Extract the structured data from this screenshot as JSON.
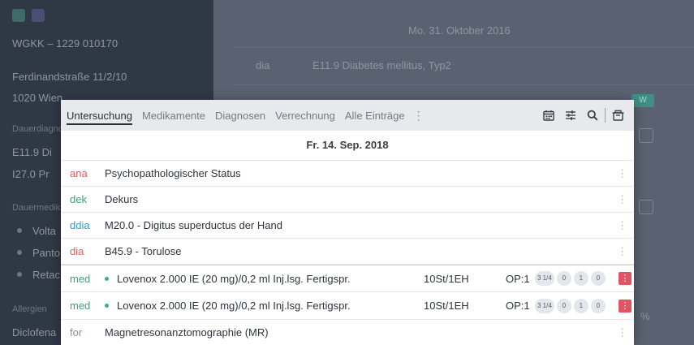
{
  "background": {
    "sidebar": {
      "insurer": "WGKK – 1229 010170",
      "address1": "Ferdinandstraße 11/2/10",
      "address2": "1020 Wien",
      "section1": "Dauerdiagnosen",
      "diag1": "E11.9 Di",
      "diag2": "I27.0 Pr",
      "section2": "Dauermedikation",
      "med1": "Volta",
      "med2": "Panto",
      "med3": "Retac",
      "section3": "Allergien",
      "allergy": "Diclofena"
    },
    "main": {
      "date": "Mo. 31. Oktober 2016",
      "entry_code": "dia",
      "entry_text": "E11.9 Diabetes mellitus, Typ2",
      "badge": "W",
      "corner_text": "%"
    }
  },
  "dialog": {
    "tabs": [
      {
        "label": "Untersuchung",
        "active": true
      },
      {
        "label": "Medikamente",
        "active": false
      },
      {
        "label": "Diagnosen",
        "active": false
      },
      {
        "label": "Verrechnung",
        "active": false
      },
      {
        "label": "Alle Einträge",
        "active": false
      }
    ],
    "tools": [
      "calendar-icon",
      "filter-sliders-icon",
      "search-icon",
      "archive-icon"
    ],
    "date_header": "Fr. 14. Sep. 2018",
    "entries": [
      {
        "code": "ana",
        "color": "#e25a5a",
        "text": "Psychopathologischer Status"
      },
      {
        "code": "dek",
        "color": "#3aa37a",
        "text": "Dekurs"
      },
      {
        "code": "ddia",
        "color": "#2f9ccf",
        "text": "M20.0 - Digitus superductus der Hand"
      },
      {
        "code": "dia",
        "color": "#e25a5a",
        "text": "B45.9 - Torulose"
      }
    ],
    "medications": [
      {
        "code": "med",
        "color": "#3aa37a",
        "text": "Lovenox 2.000 IE (20 mg)/0,2 ml Inj.lsg. Fertigspr.",
        "qty": "10St/1EH",
        "op": "OP:1",
        "doses": [
          "3 1/4",
          "0",
          "1",
          "0"
        ]
      },
      {
        "code": "med",
        "color": "#3aa37a",
        "text": "Lovenox 2.000 IE (20 mg)/0,2 ml Inj.lsg. Fertigspr.",
        "qty": "10St/1EH",
        "op": "OP:1",
        "doses": [
          "3 1/4",
          "0",
          "1",
          "0"
        ]
      }
    ],
    "last_entry": {
      "code": "for",
      "color": "#8a8f97",
      "text": "Magnetresonanztomographie (MR)"
    }
  }
}
